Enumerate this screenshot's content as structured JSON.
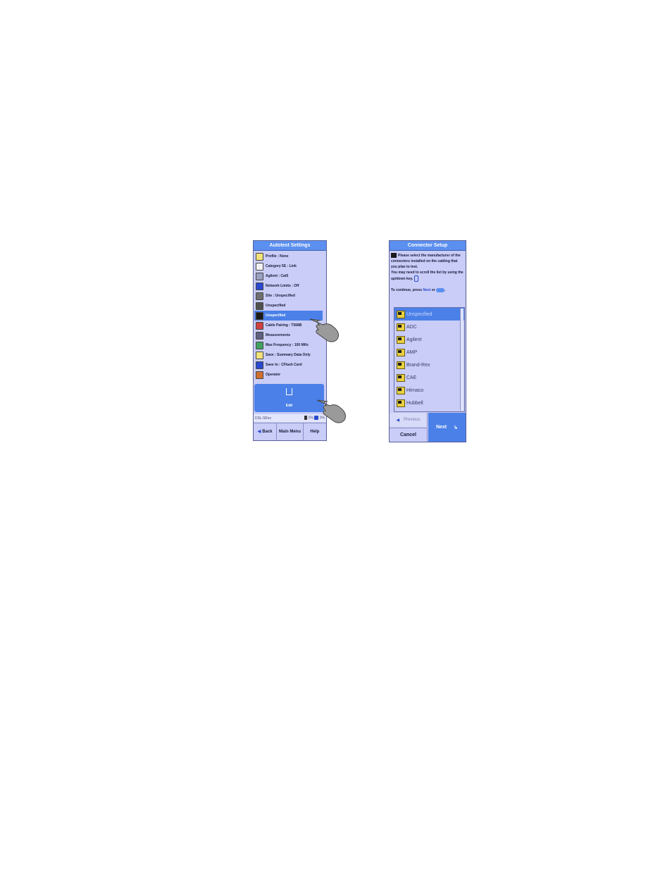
{
  "left_screen": {
    "title": "Autotest Settings",
    "menu_items": [
      {
        "label": "Profile : None",
        "icon": "document-icon",
        "color": "#f3e27a"
      },
      {
        "label": "Category 5E : Link",
        "icon": "document-icon",
        "color": "#f3f3f3"
      },
      {
        "label": "Agilent : Cat5",
        "icon": "cable-icon",
        "color": "#9aa0c0"
      },
      {
        "label": "Network Limits : Off",
        "icon": "network-icon",
        "color": "#2a48d0"
      },
      {
        "label": "Site : Unspecified",
        "icon": "printer-icon",
        "color": "#707070"
      },
      {
        "label": "Unspecified",
        "icon": "cable-icon",
        "color": "#505050"
      },
      {
        "label": "Unspecified",
        "icon": "connector-icon",
        "color": "#1a1a1a"
      },
      {
        "label": "Cable Pairing : T568B",
        "icon": "pairing-icon",
        "color": "#d04040"
      },
      {
        "label": "Measurements",
        "icon": "wrench-icon",
        "color": "#606080"
      },
      {
        "label": "Max Frequency : 100 MHz",
        "icon": "chart-icon",
        "color": "#40a060"
      },
      {
        "label": "Save : Summary Data Only",
        "icon": "save-icon",
        "color": "#f3e27a"
      },
      {
        "label": "Save to : CFlash Card",
        "icon": "disk-icon",
        "color": "#2a48d0"
      },
      {
        "label": "Operator",
        "icon": "person-icon",
        "color": "#d07030"
      }
    ],
    "selected_index": 6,
    "edit_label": "Edit",
    "status_left": "DSL-5Rev",
    "status_mem1": "0%",
    "status_mem2": "0%",
    "nav": {
      "back": "Back",
      "main_menu": "Main Menu",
      "help": "Help"
    }
  },
  "right_screen": {
    "title": "Connector Setup",
    "instructions": {
      "line1": "Please select the manufacturer of the connectors installed on the cabling that you plan to test.",
      "line2": "You may need to scroll the list by using the up/down key.",
      "line3_prefix": "To continue, press",
      "line3_next": "Next",
      "line3_or": "or"
    },
    "list_items": [
      "Unspecified",
      "ADC",
      "Agilent",
      "AMP",
      "Brand-Rex",
      "CAE",
      "Hirnaco",
      "Hubbell"
    ],
    "selected_index": 0,
    "previous_label": "Previous",
    "cancel_label": "Cancel",
    "next_label": "Next"
  },
  "colors": {
    "screen_bg": "#c9cdf7",
    "title_bar": "#5b8ff0",
    "selection": "#4a80e8"
  }
}
